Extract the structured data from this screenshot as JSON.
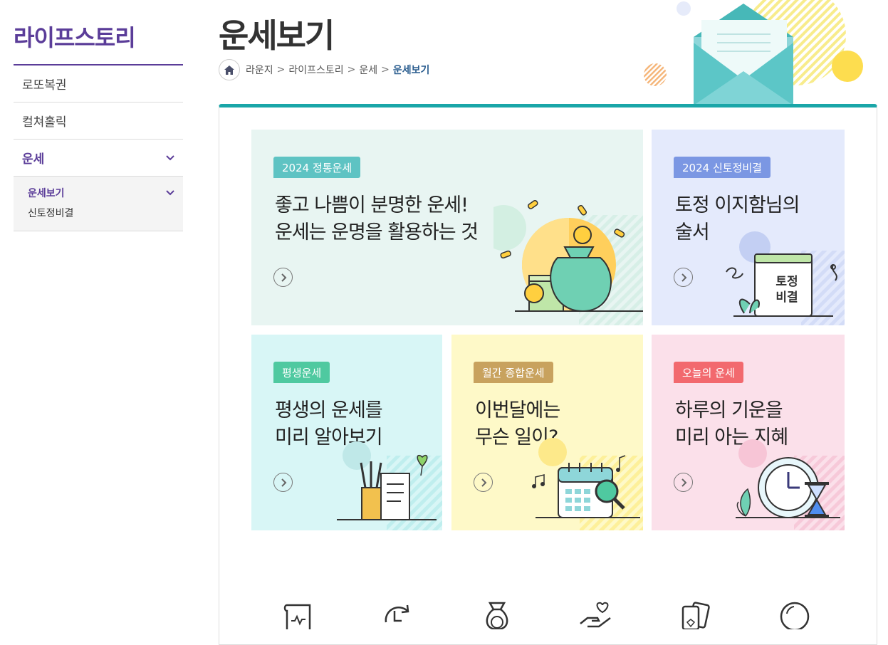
{
  "sidebar": {
    "title": "라이프스토리",
    "items": [
      {
        "label": "로또복권"
      },
      {
        "label": "컬쳐홀릭"
      },
      {
        "label": "운세"
      }
    ],
    "submenu": [
      {
        "label": "운세보기"
      },
      {
        "label": "신토정비결"
      }
    ]
  },
  "header": {
    "title": "운세보기",
    "breadcrumb": [
      "라운지",
      "라이프스토리",
      "운세",
      "운세보기"
    ],
    "separator": ">"
  },
  "cards": [
    {
      "badge": "2024 정통운세",
      "line1": "좋고 나쁨이 분명한 운세!",
      "line2": "운세는 운명을 활용하는 것",
      "bg": "#e8f5f2",
      "badge_color": "#5ec3c3"
    },
    {
      "badge": "2024 신토정비결",
      "line1": "토정 이지함님의",
      "line2": "술서",
      "bg": "#e4eafc",
      "badge_color": "#7b97e3",
      "book_label_1": "토정",
      "book_label_2": "비결"
    },
    {
      "badge": "평생운세",
      "line1": "평생의 운세를",
      "line2": "미리 알아보기",
      "bg": "#d8f6f6",
      "badge_color": "#4fc9a0"
    },
    {
      "badge": "월간 종합운세",
      "line1": "이번달에는",
      "line2": "무슨 일이?",
      "bg": "#fef9c8",
      "badge_color": "#c8a25e"
    },
    {
      "badge": "오늘의 운세",
      "line1": "하루의 기운을",
      "line2": "미리 아는 지혜",
      "bg": "#fbe0ea",
      "badge_color": "#f2696e"
    }
  ],
  "icons": [
    "scroll-icon",
    "refresh-icon",
    "money-bag-icon",
    "heart-hand-icon",
    "tarot-card-icon",
    "crystal-ball-icon"
  ]
}
